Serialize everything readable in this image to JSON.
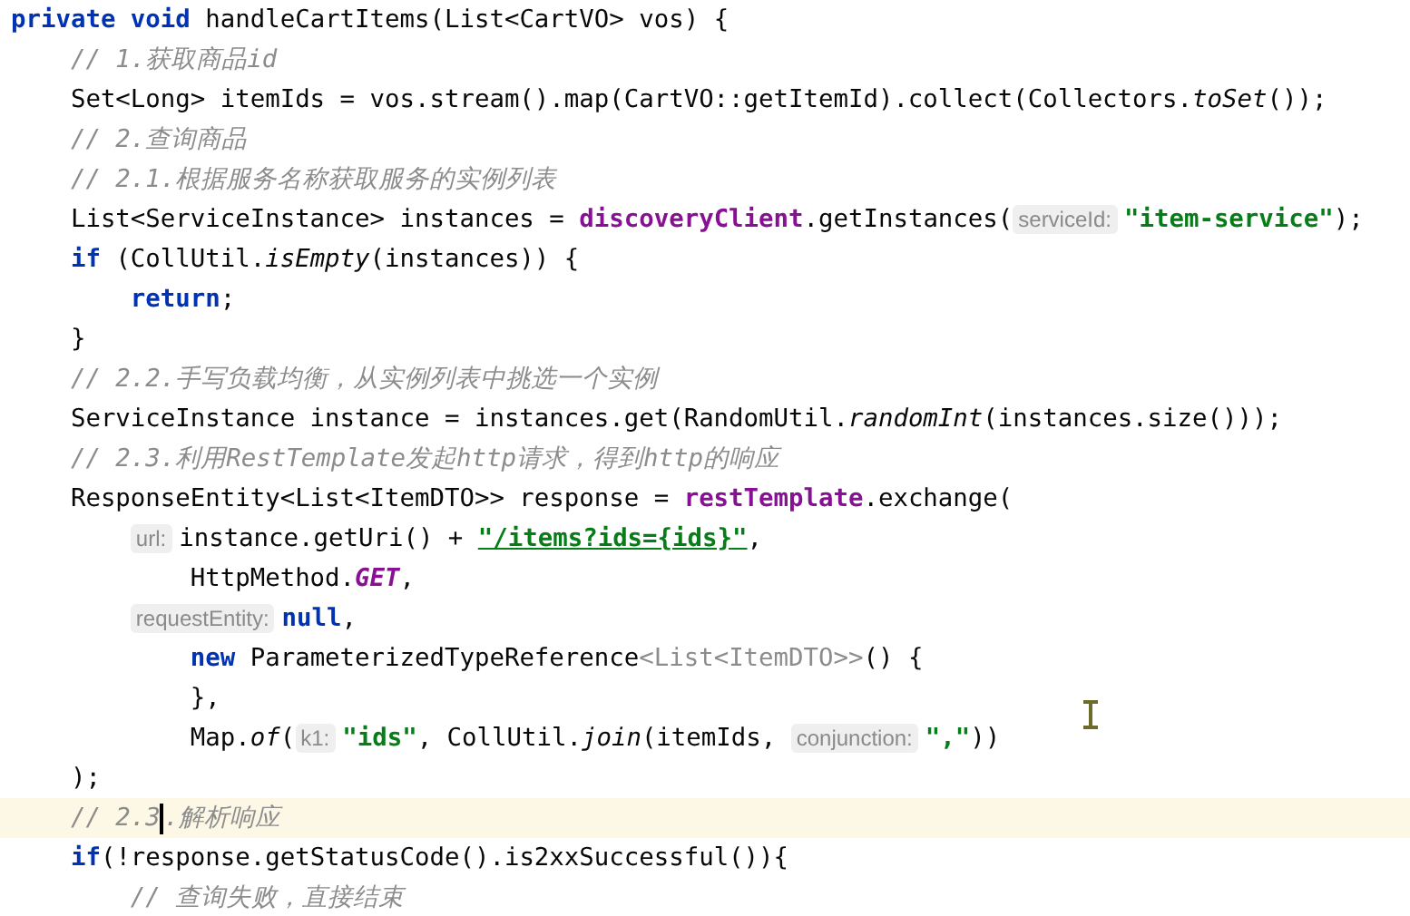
{
  "editor": {
    "lines": [
      {
        "current": false,
        "tokens": [
          {
            "kind": "keyword",
            "text": "private void "
          },
          {
            "kind": "plain",
            "text": "handleCartItems(List<CartVO> vos) {"
          }
        ]
      },
      {
        "current": false,
        "tokens": [
          {
            "kind": "comment",
            "text": "    // 1.获取商品id"
          }
        ]
      },
      {
        "current": false,
        "tokens": [
          {
            "kind": "plain",
            "text": "    Set<Long> itemIds = vos.stream().map(CartVO::getItemId).collect(Collectors."
          },
          {
            "kind": "static",
            "text": "toSet"
          },
          {
            "kind": "plain",
            "text": "());"
          }
        ]
      },
      {
        "current": false,
        "tokens": [
          {
            "kind": "comment",
            "text": "    // 2.查询商品"
          }
        ]
      },
      {
        "current": false,
        "tokens": [
          {
            "kind": "comment",
            "text": "    // 2.1.根据服务名称获取服务的实例列表"
          }
        ]
      },
      {
        "current": false,
        "tokens": [
          {
            "kind": "plain",
            "text": "    List<ServiceInstance> instances = "
          },
          {
            "kind": "field",
            "text": "discoveryClient"
          },
          {
            "kind": "plain",
            "text": ".getInstances("
          },
          {
            "kind": "hint",
            "text": "serviceId:"
          },
          {
            "kind": "string",
            "text": "\"item-service\""
          },
          {
            "kind": "plain",
            "text": ");"
          }
        ]
      },
      {
        "current": false,
        "tokens": [
          {
            "kind": "keyword",
            "text": "    if "
          },
          {
            "kind": "plain",
            "text": "(CollUtil."
          },
          {
            "kind": "static",
            "text": "isEmpty"
          },
          {
            "kind": "plain",
            "text": "(instances)) {"
          }
        ]
      },
      {
        "current": false,
        "tokens": [
          {
            "kind": "keyword",
            "text": "        return"
          },
          {
            "kind": "plain",
            "text": ";"
          }
        ]
      },
      {
        "current": false,
        "tokens": [
          {
            "kind": "plain",
            "text": "    }"
          }
        ]
      },
      {
        "current": false,
        "tokens": [
          {
            "kind": "comment",
            "text": "    // 2.2.手写负载均衡，从实例列表中挑选一个实例"
          }
        ]
      },
      {
        "current": false,
        "tokens": [
          {
            "kind": "plain",
            "text": "    ServiceInstance instance = instances.get(RandomUtil."
          },
          {
            "kind": "static",
            "text": "randomInt"
          },
          {
            "kind": "plain",
            "text": "(instances.size()));"
          }
        ]
      },
      {
        "current": false,
        "tokens": [
          {
            "kind": "comment",
            "text": "    // 2.3.利用RestTemplate发起http请求，得到http的响应"
          }
        ]
      },
      {
        "current": false,
        "tokens": [
          {
            "kind": "plain",
            "text": "    ResponseEntity<List<ItemDTO>> response = "
          },
          {
            "kind": "field",
            "text": "restTemplate"
          },
          {
            "kind": "plain",
            "text": ".exchange("
          }
        ]
      },
      {
        "current": false,
        "tokens": [
          {
            "kind": "indent"
          },
          {
            "kind": "hint",
            "text": "url:"
          },
          {
            "kind": "plain",
            "text": "instance.getUri() + "
          },
          {
            "kind": "link-string",
            "text": "\"/items?ids={ids}\""
          },
          {
            "kind": "plain",
            "text": ","
          }
        ]
      },
      {
        "current": false,
        "tokens": [
          {
            "kind": "plain",
            "text": "            HttpMethod."
          },
          {
            "kind": "constant",
            "text": "GET"
          },
          {
            "kind": "plain",
            "text": ","
          }
        ]
      },
      {
        "current": false,
        "tokens": [
          {
            "kind": "indent"
          },
          {
            "kind": "hint",
            "text": "requestEntity:"
          },
          {
            "kind": "keyword",
            "text": "null"
          },
          {
            "kind": "plain",
            "text": ","
          }
        ]
      },
      {
        "current": false,
        "tokens": [
          {
            "kind": "keyword",
            "text": "            new "
          },
          {
            "kind": "plain",
            "text": "ParameterizedTypeReference"
          },
          {
            "kind": "dim",
            "text": "<List<ItemDTO>>"
          },
          {
            "kind": "plain",
            "text": "() {"
          }
        ]
      },
      {
        "current": false,
        "tokens": [
          {
            "kind": "plain",
            "text": "            },"
          }
        ]
      },
      {
        "current": false,
        "tokens": [
          {
            "kind": "plain",
            "text": "            Map."
          },
          {
            "kind": "static",
            "text": "of"
          },
          {
            "kind": "plain",
            "text": "("
          },
          {
            "kind": "hint",
            "text": "k1:"
          },
          {
            "kind": "string",
            "text": "\"ids\""
          },
          {
            "kind": "plain",
            "text": ", CollUtil."
          },
          {
            "kind": "static",
            "text": "join"
          },
          {
            "kind": "plain",
            "text": "(itemIds, "
          },
          {
            "kind": "hint",
            "text": "conjunction:"
          },
          {
            "kind": "string",
            "text": "\",\""
          },
          {
            "kind": "plain",
            "text": "))"
          }
        ]
      },
      {
        "current": false,
        "tokens": [
          {
            "kind": "plain",
            "text": "    );"
          }
        ]
      },
      {
        "current": true,
        "tokens": [
          {
            "kind": "comment",
            "text": "    // 2.3"
          },
          {
            "kind": "caret"
          },
          {
            "kind": "comment",
            "text": ".解析响应"
          }
        ]
      },
      {
        "current": false,
        "tokens": [
          {
            "kind": "keyword",
            "text": "    if"
          },
          {
            "kind": "plain",
            "text": "(!response.getStatusCode().is2xxSuccessful()){"
          }
        ]
      },
      {
        "current": false,
        "tokens": [
          {
            "kind": "comment",
            "text": "        // 查询失败，直接结束"
          }
        ]
      }
    ]
  }
}
